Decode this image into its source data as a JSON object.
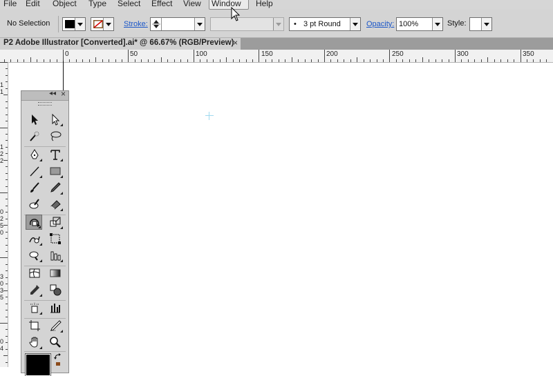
{
  "menu": [
    "File",
    "Edit",
    "Object",
    "Type",
    "Select",
    "Effect",
    "View",
    "Window",
    "Help"
  ],
  "menu_active": "Window",
  "control": {
    "selection": "No Selection",
    "stroke_label": "Stroke:",
    "brush": "3 pt Round",
    "opacity_label": "Opacity:",
    "opacity_value": "100%",
    "style_label": "Style:"
  },
  "doc_tab": {
    "title": "P2 Adobe Illustrator [Converted].ai* @ 66.67% (RGB/Preview)",
    "close": "×"
  },
  "ruler": {
    "h": [
      "0",
      "50",
      "100",
      "150",
      "200",
      "250",
      "300",
      "350"
    ],
    "v": [
      "1",
      "1",
      "1",
      "2",
      "2",
      "0",
      "2",
      "5",
      "0",
      "3",
      "0",
      "3",
      "5",
      "0",
      "4"
    ]
  },
  "tools_panel": {
    "collapse": "◂◂",
    "close": "×",
    "tools": [
      "selection-tool",
      "direct-selection-tool",
      "magic-wand-tool",
      "lasso-tool",
      "pen-tool",
      "type-tool",
      "line-segment-tool",
      "rectangle-tool",
      "paintbrush-tool",
      "pencil-tool",
      "blob-brush-tool",
      "eraser-tool",
      "rotate-tool",
      "scale-tool",
      "warp-tool",
      "free-transform-tool",
      "symbol-sprayer-tool",
      "column-graph-tool",
      "mesh-tool",
      "gradient-tool",
      "eyedropper-tool",
      "blend-tool",
      "live-paint-bucket-tool",
      "graph-tool",
      "artboard-tool",
      "slice-tool",
      "hand-tool",
      "zoom-tool"
    ]
  },
  "colors": {
    "accent_link": "#1a56c8",
    "fill": "#000000"
  }
}
